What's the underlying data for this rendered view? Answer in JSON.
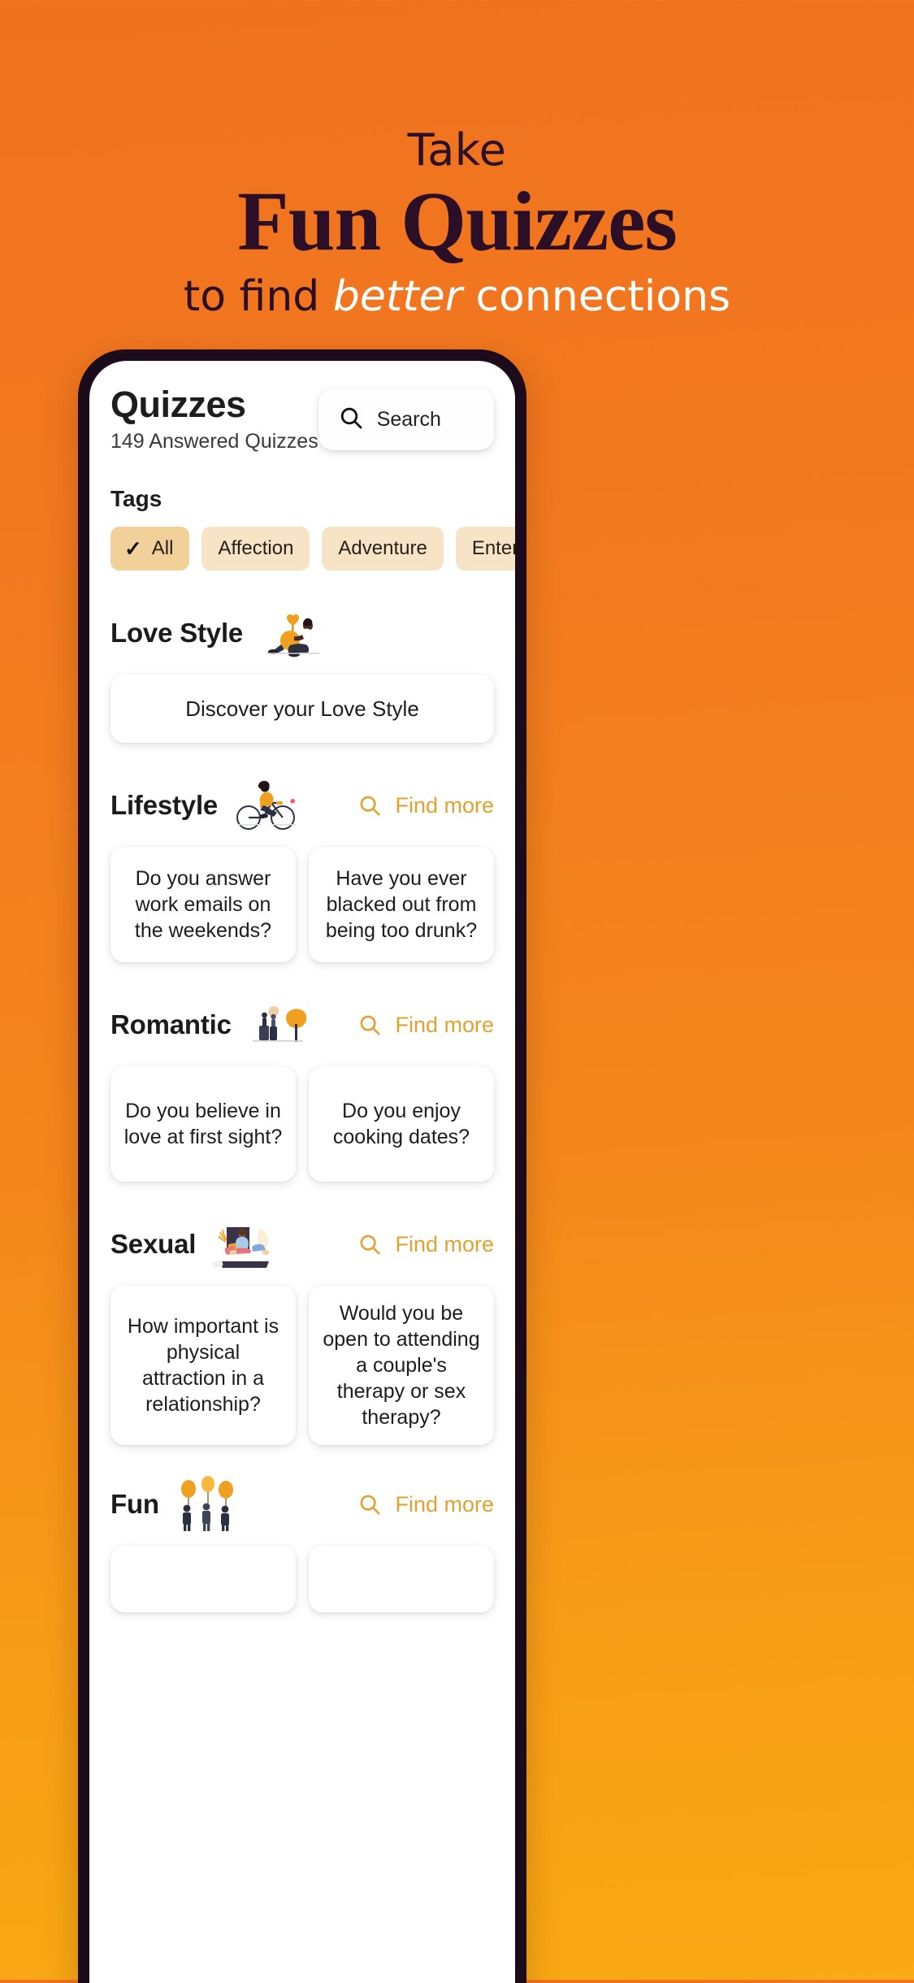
{
  "hero": {
    "line1": "Take",
    "line2": "Fun Quizzes",
    "line3_prefix": "to find ",
    "line3_italic": "better",
    "line3_suffix": " connections",
    "bg_start": "#F0721F",
    "bg_end": "#F9A913",
    "dark_color": "#2B0F26"
  },
  "app": {
    "title": "Quizzes",
    "subtitle": "149 Answered Quizzes",
    "search": {
      "placeholder": "Search",
      "icon": "search-icon"
    },
    "tags_label": "Tags",
    "tags": [
      {
        "label": "All",
        "selected": true,
        "icon": "check-icon"
      },
      {
        "label": "Affection",
        "selected": false
      },
      {
        "label": "Adventure",
        "selected": false
      },
      {
        "label": "Entertainment",
        "selected": false
      }
    ],
    "find_more_label": "Find more",
    "accent_color": "#E0A230",
    "sections": [
      {
        "title": "Love Style",
        "illustration": "woman-with-hearts-illustration",
        "has_find_more": false,
        "banner": "Discover your Love Style",
        "cards": []
      },
      {
        "title": "Lifestyle",
        "illustration": "woman-on-bicycle-illustration",
        "has_find_more": true,
        "cards": [
          "Do you answer work emails on the weekends?",
          "Have you ever blacked out from being too drunk?"
        ]
      },
      {
        "title": "Romantic",
        "illustration": "couple-under-tree-illustration",
        "has_find_more": true,
        "cards": [
          "Do you believe in love at first sight?",
          "Do you enjoy cooking dates?"
        ]
      },
      {
        "title": "Sexual",
        "illustration": "couple-in-bed-illustration",
        "has_find_more": true,
        "cards": [
          "How important is physical attraction in a relationship?",
          "Would you be open to attending a couple's therapy or sex therapy?"
        ]
      },
      {
        "title": "Fun",
        "illustration": "people-with-balloons-illustration",
        "has_find_more": true,
        "cards": []
      }
    ]
  }
}
